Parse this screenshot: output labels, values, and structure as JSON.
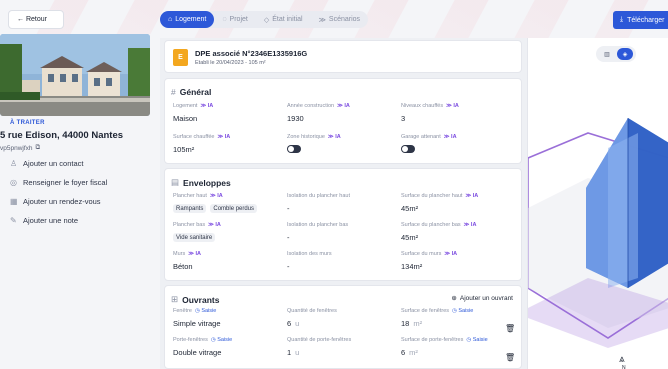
{
  "header": {
    "back_label": "← Retour",
    "tabs": [
      {
        "label": "Logement",
        "icon": "home-icon"
      },
      {
        "label": "Projet",
        "icon": "chat-icon"
      },
      {
        "label": "État initial",
        "icon": "tag-icon"
      },
      {
        "label": "Scénarios",
        "icon": "sparkle-icon"
      }
    ],
    "download_label": "Télécharger"
  },
  "property": {
    "status": "À TRAITER",
    "address": "5 rue Edison, 44000 Nantes",
    "reference": "vp5pnwjfxh"
  },
  "actions": [
    {
      "label": "Ajouter un contact",
      "icon": "person-icon"
    },
    {
      "label": "Renseigner le foyer fiscal",
      "icon": "coin-icon"
    },
    {
      "label": "Ajouter un rendez-vous",
      "icon": "calendar-icon"
    },
    {
      "label": "Ajouter une note",
      "icon": "note-icon"
    }
  ],
  "dpe": {
    "letter": "E",
    "title": "DPE associé N°2346E1335916G",
    "subtitle": "Etabli le 20/04/2023 - 105 m²"
  },
  "general": {
    "title": "Général",
    "ia": "≫ IA",
    "logement_label": "Logement",
    "logement_value": "Maison",
    "annee_label": "Année construction",
    "annee_value": "1930",
    "niveaux_label": "Niveaux chauffés",
    "niveaux_value": "3",
    "surface_label": "Surface chauffée",
    "surface_value": "105m²",
    "zone_label": "Zone historique",
    "garage_label": "Garage attenant"
  },
  "enveloppes": {
    "title": "Enveloppes",
    "ph_label": "Plancher haut",
    "ph_chips": [
      "Rampants",
      "Comble perdus"
    ],
    "ph_iso_label": "Isolation du plancher haut",
    "ph_iso_value": "-",
    "ph_surf_label": "Surface du plancher haut",
    "ph_surf_value": "45m²",
    "pb_label": "Plancher bas",
    "pb_chips": [
      "Vide sanitaire"
    ],
    "pb_iso_label": "Isolation du plancher bas",
    "pb_iso_value": "-",
    "pb_surf_label": "Surface du plancher bas",
    "pb_surf_value": "45m²",
    "murs_label": "Murs",
    "murs_value": "Béton",
    "murs_iso_label": "Isolation des murs",
    "murs_iso_value": "-",
    "murs_surf_label": "Surface du murs",
    "murs_surf_value": "134m²"
  },
  "ouvrants": {
    "title": "Ouvrants",
    "add_label": "Ajouter un ouvrant",
    "saisie": "Saisie",
    "fen_label": "Fenêtre",
    "fen_value": "Simple vitrage",
    "fen_qty_label": "Quantité de fenêtres",
    "fen_qty_value": "6",
    "fen_qty_unit": "u",
    "fen_surf_label": "Surface de fenêtres",
    "fen_surf_value": "18",
    "fen_surf_unit": "m²",
    "pf_label": "Porte-fenêtres",
    "pf_value": "Double vitrage",
    "pf_qty_label": "Quantité de porte-fenêtres",
    "pf_qty_value": "1",
    "pf_qty_unit": "u",
    "pf_surf_label": "Surface de porte-fenêtres",
    "pf_surf_value": "6",
    "pf_surf_unit": "m²"
  },
  "viewer": {
    "compass_label": "N"
  }
}
